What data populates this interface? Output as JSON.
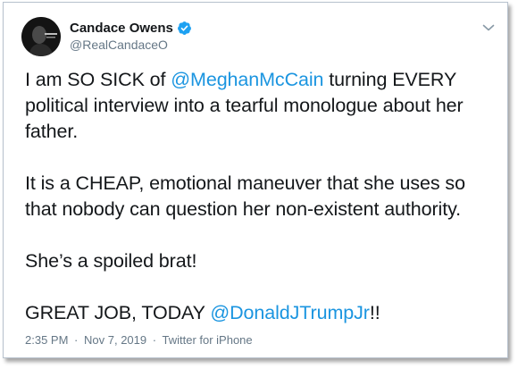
{
  "author": {
    "display_name": "Candace Owens",
    "handle": "@RealCandaceO"
  },
  "tweet": {
    "paragraphs": [
      {
        "parts": [
          {
            "text": "I am SO SICK of ",
            "mention": false
          },
          {
            "text": "@MeghanMcCain",
            "mention": true
          },
          {
            "text": " turning EVERY political interview into a tearful monologue about her father.",
            "mention": false
          }
        ]
      },
      {
        "parts": [
          {
            "text": "It is a CHEAP, emotional maneuver that she uses so that nobody can question her non-existent authority.",
            "mention": false
          }
        ]
      },
      {
        "parts": [
          {
            "text": "She’s a spoiled brat!",
            "mention": false
          }
        ]
      },
      {
        "parts": [
          {
            "text": "GREAT JOB, TODAY ",
            "mention": false
          },
          {
            "text": "@DonaldJTrumpJr",
            "mention": true
          },
          {
            "text": "!!",
            "mention": false
          }
        ]
      }
    ]
  },
  "meta": {
    "time": "2:35 PM",
    "date": "Nov 7, 2019",
    "separator": "·",
    "source": "Twitter for iPhone"
  },
  "icons": {
    "verified": "verified-badge-icon",
    "caret": "chevron-down-icon"
  },
  "colors": {
    "mention": "#1b95e0",
    "verified": "#1da1f2",
    "meta": "#657786",
    "text": "#14171a"
  }
}
